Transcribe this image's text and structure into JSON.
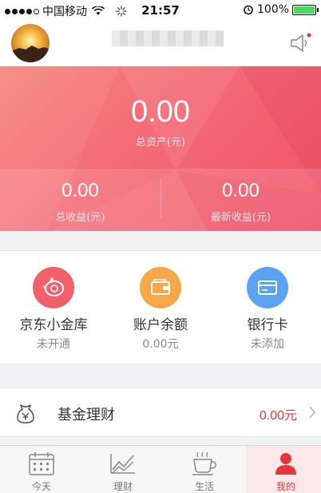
{
  "status_bar": {
    "carrier": "中国移动",
    "time": "21:57",
    "battery": "100%",
    "battery_level": 1.0
  },
  "header": {
    "avatar_icon": "sunset-avatar",
    "speaker_icon": "speaker-icon"
  },
  "assets": {
    "total_value": "0.00",
    "total_label": "总资产(元)",
    "earnings_value": "0.00",
    "earnings_label": "总收益(元)",
    "latest_value": "0.00",
    "latest_label": "最新收益(元)"
  },
  "quick_actions": [
    {
      "title": "京东小金库",
      "sub": "未开通",
      "icon": "piggy-bank-icon",
      "color": "#f2606a"
    },
    {
      "title": "账户余额",
      "sub": "0.00元",
      "icon": "wallet-icon",
      "color": "#f5a84a"
    },
    {
      "title": "银行卡",
      "sub": "未添加",
      "icon": "card-icon",
      "color": "#5aa3f0"
    }
  ],
  "fund": {
    "label": "基金理财",
    "value": "0.00元",
    "icon": "fund-bag-icon"
  },
  "tabs": [
    {
      "label": "今天",
      "icon": "calendar-icon",
      "active": false
    },
    {
      "label": "理财",
      "icon": "chart-icon",
      "active": false
    },
    {
      "label": "生活",
      "icon": "coffee-icon",
      "active": false
    },
    {
      "label": "我的",
      "icon": "user-icon",
      "active": true
    }
  ],
  "colors": {
    "accent_red": "#e4393c",
    "hero_start": "#f6887f",
    "hero_end": "#f0536a"
  }
}
